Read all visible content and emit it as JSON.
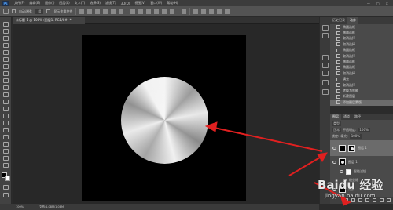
{
  "menubar": {
    "logo": "Ps",
    "items": [
      "文件(F)",
      "编辑(E)",
      "图像(I)",
      "图层(L)",
      "文字(Y)",
      "选择(S)",
      "滤镜(T)",
      "3D(D)",
      "视图(V)",
      "窗口(W)",
      "帮助(H)"
    ],
    "controls": [
      "—",
      "□",
      "×"
    ]
  },
  "options": {
    "preset": "自动选择:",
    "target": "组",
    "transform": "显示变换控件"
  },
  "document": {
    "tab": "未标题-1 @ 100% (图层1, RGB/8#) *"
  },
  "status": {
    "zoom": "100%",
    "doc": "文档:1.08M/1.08M"
  },
  "history": {
    "tabs": [
      "历史记录",
      "动作"
    ],
    "items": [
      "椭圆选框",
      "椭圆选框",
      "取消选择",
      "取消选择",
      "椭圆选框",
      "取消选择",
      "椭圆选框",
      "椭圆选框",
      "取消选择",
      "填充",
      "取消选择",
      "转换为智能",
      "新建图层",
      "添加图层蒙版"
    ]
  },
  "layers": {
    "tabs": [
      "图层",
      "通道",
      "路径"
    ],
    "kind": "类型",
    "mode": "正常",
    "opacity_label": "不透明度:",
    "opacity": "100%",
    "lock_label": "锁定:",
    "fill_label": "填充:",
    "fill": "100%",
    "rows": [
      {
        "name": "图层 1"
      },
      {
        "name": "图层 1"
      },
      {
        "name": "智能滤镜"
      },
      {
        "name": "极坐标"
      },
      {
        "name": "背景"
      }
    ]
  },
  "watermark": {
    "brand": "Baidu 经验",
    "url": "jingyan.baidu.com"
  },
  "colors": {
    "annotation": "#e02020"
  }
}
